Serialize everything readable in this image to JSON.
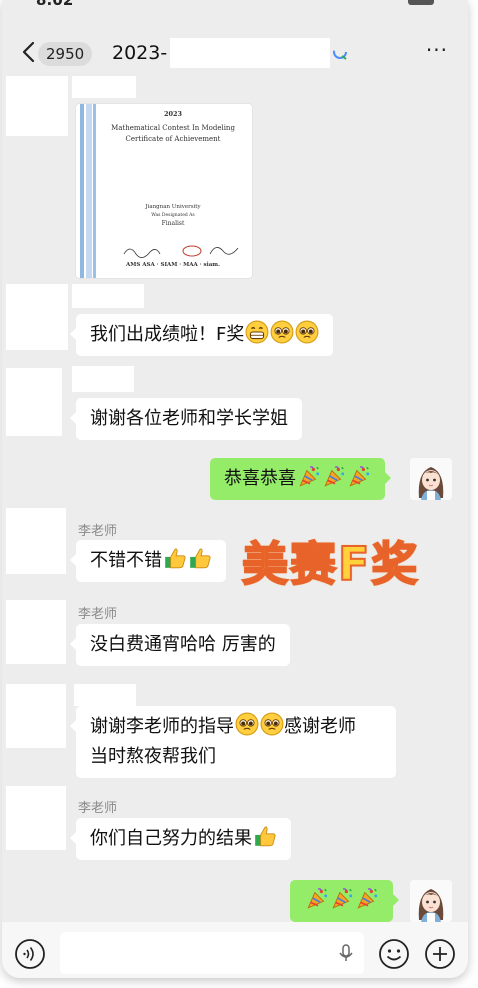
{
  "status_bar": {
    "time": "8:02",
    "extra": "···"
  },
  "header": {
    "back_icon": "chevron-left-icon",
    "unread_count": "2950",
    "title": "2023-",
    "more_icon": "ellipsis-icon"
  },
  "certificate": {
    "year": "2023",
    "line1": "Mathematical Contest In Modeling",
    "line2": "Certificate of Achievement",
    "school": "Jiangnan University",
    "designated": "Was Designated As",
    "award": "Finalist",
    "logos": "AMS ASA · SIAM · MAA · siam."
  },
  "messages": [
    {
      "side": "left",
      "text": "我们出成绩啦！F奖",
      "emojis": [
        "grin-icon",
        "pleading-face-icon",
        "pleading-face-icon"
      ]
    },
    {
      "side": "left",
      "text": "谢谢各位老师和学长学姐"
    },
    {
      "side": "right",
      "text": "恭喜恭喜",
      "emojis": [
        "party-popper-icon",
        "party-popper-icon",
        "party-popper-icon"
      ]
    },
    {
      "side": "left",
      "sender": "李老师",
      "text": "不错不错",
      "emojis": [
        "thumbs-up-icon",
        "thumbs-up-icon"
      ]
    },
    {
      "side": "left",
      "sender": "李老师",
      "text": "没白费通宵哈哈 厉害的"
    },
    {
      "side": "left",
      "text_line1": "谢谢李老师的指导",
      "text_line1_after": "感谢老师",
      "text_line2": "当时熬夜帮我们",
      "emojis": [
        "pleading-face-icon",
        "pleading-face-icon"
      ]
    },
    {
      "side": "left",
      "sender": "李老师",
      "text": "你们自己努力的结果",
      "emojis": [
        "thumbs-up-icon"
      ]
    },
    {
      "side": "right",
      "text": "",
      "emojis": [
        "party-popper-icon",
        "party-popper-icon",
        "party-popper-icon"
      ]
    }
  ],
  "overlay_text": "美赛F奖",
  "input_bar": {
    "voice_icon": "voice-icon",
    "mic_icon": "mic-icon",
    "emoji_icon": "smiley-icon",
    "add_icon": "plus-icon"
  },
  "colors": {
    "chat_bg": "#ededed",
    "self_bubble": "#95ec69",
    "other_bubble": "#ffffff",
    "overlay": "#ffd23c"
  }
}
